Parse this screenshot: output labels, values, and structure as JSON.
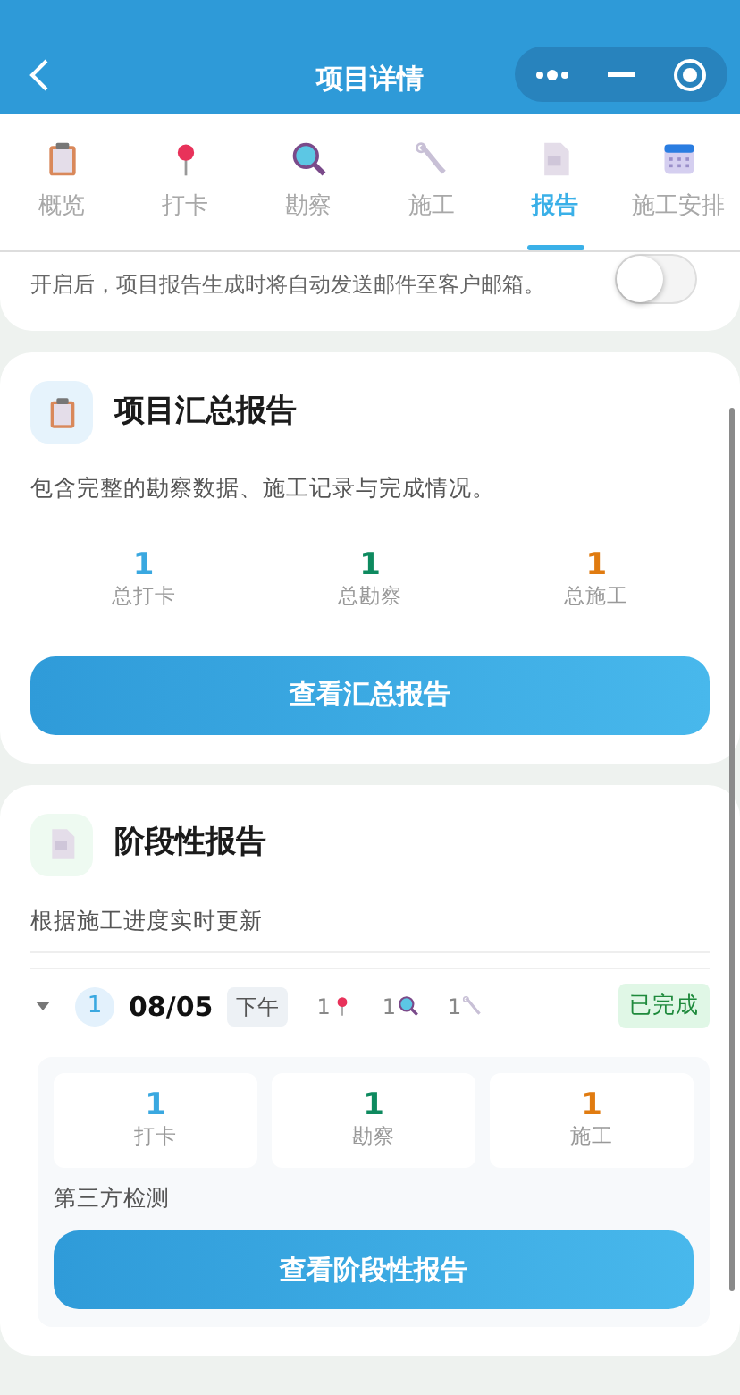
{
  "header": {
    "title": "项目详情"
  },
  "tabs": [
    {
      "label": "概览",
      "kind": "clipboard",
      "selected": false
    },
    {
      "label": "打卡",
      "kind": "pin",
      "selected": false
    },
    {
      "label": "勘察",
      "kind": "magnifier",
      "selected": false
    },
    {
      "label": "施工",
      "kind": "wrench",
      "selected": false
    },
    {
      "label": "报告",
      "kind": "document",
      "selected": true
    },
    {
      "label": "施工安排",
      "kind": "calendar",
      "selected": false
    }
  ],
  "email_setting": {
    "description": "开启后，项目报告生成时将自动发送邮件至客户邮箱。",
    "on": false
  },
  "summary_report": {
    "title": "项目汇总报告",
    "description": "包含完整的勘察数据、施工记录与完成情况。",
    "stats": [
      {
        "value": "1",
        "label": "总打卡",
        "color": "#3aa8e0"
      },
      {
        "value": "1",
        "label": "总勘察",
        "color": "#0e8a5f"
      },
      {
        "value": "1",
        "label": "总施工",
        "color": "#e07b10"
      }
    ],
    "button": "查看汇总报告"
  },
  "stage_report": {
    "title": "阶段性报告",
    "description": "根据施工进度实时更新",
    "stages": [
      {
        "index": "1",
        "date": "08/05",
        "period": "下午",
        "expanded": true,
        "counts": [
          {
            "value": "1",
            "kind": "pin"
          },
          {
            "value": "1",
            "kind": "magnifier"
          },
          {
            "value": "1",
            "kind": "wrench"
          }
        ],
        "status": "已完成",
        "stats": [
          {
            "value": "1",
            "label": "打卡",
            "color": "#3aa8e0"
          },
          {
            "value": "1",
            "label": "勘察",
            "color": "#0e8a5f"
          },
          {
            "value": "1",
            "label": "施工",
            "color": "#e07b10"
          }
        ],
        "note": "第三方检测",
        "button": "查看阶段性报告"
      }
    ]
  }
}
